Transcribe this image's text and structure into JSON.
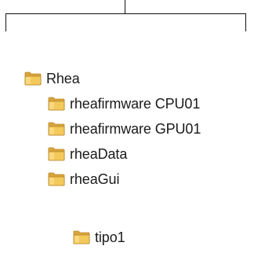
{
  "tree": {
    "root": {
      "label": "Rhea",
      "icon": "folder-icon",
      "children": [
        {
          "label": "rheafirmware CPU01",
          "icon": "folder-icon"
        },
        {
          "label": "rheafirmware GPU01",
          "icon": "folder-icon"
        },
        {
          "label": "rheaData",
          "icon": "folder-icon"
        },
        {
          "label": "rheaGui",
          "icon": "folder-icon",
          "children": [
            {
              "label": "tipo1",
              "icon": "folder-icon"
            }
          ]
        }
      ]
    }
  },
  "colors": {
    "folder_front": "#f4c95b",
    "folder_back": "#d9a43a",
    "folder_edge": "#b8862a",
    "text": "#1a1a1a",
    "frame_line": "#111111"
  }
}
